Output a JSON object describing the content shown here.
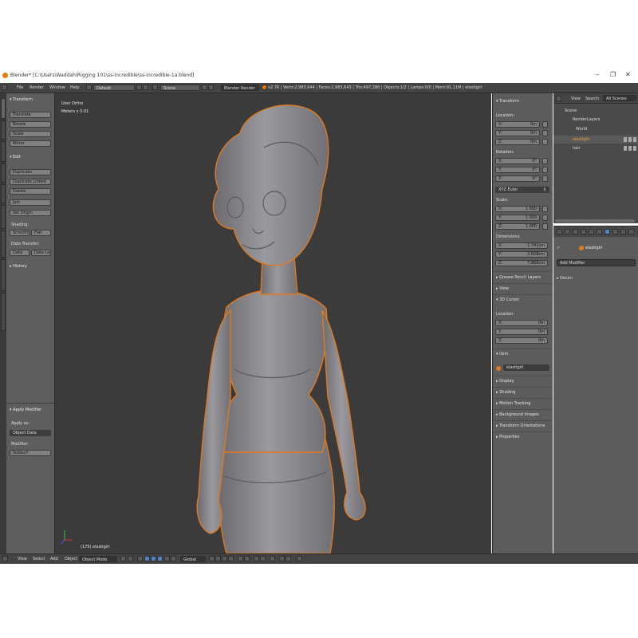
{
  "window": {
    "title": "Blender* [C:\\Users\\Waddah\\Rigging 101\\ss-incredible\\ss-incredible-1a.blend]",
    "controls": [
      "–",
      "❐",
      "✕"
    ]
  },
  "menubar": {
    "menus": [
      "File",
      "Render",
      "Window",
      "Help"
    ],
    "layout": "Default",
    "scene": "Scene",
    "engine": "Blender Render",
    "stats": "v2.76 | Verts:2,983,644 | Faces:2,983,643 | Tris:497,280 | Objects:1/2 | Lamps:0/0 | Mem:91.11M | elastigirl"
  },
  "tools": {
    "transform_header": "▾ Transform",
    "transform": [
      "Translate",
      "Rotate",
      "Scale",
      "Mirror"
    ],
    "edit_header": "▾ Edit",
    "edit": [
      "Duplicate",
      "Duplicate Linked",
      "Delete",
      "Join"
    ],
    "set_origin": "Set Origin",
    "shading_label": "Shading:",
    "shading": [
      "Smooth",
      "Flat"
    ],
    "data_transfer_label": "Data Transfer:",
    "data_transfer": [
      "Data",
      "Data Lay"
    ],
    "history_header": "▸ History",
    "apply_modifier_header": "▾ Apply Modifier",
    "apply_as_label": "Apply as:",
    "apply_as_value": "Object Data",
    "modifier_label": "Modifier:",
    "modifier_value": "Subsurf"
  },
  "viewport": {
    "view_name": "User Ortho",
    "meters": "Meters x 0.01",
    "object_label": "(175) elastigirl"
  },
  "npanel": {
    "transform_header": "▾ Transform",
    "location_label": "Location:",
    "location": [
      {
        "k": "X:",
        "v": "0m"
      },
      {
        "k": "Y:",
        "v": "0m"
      },
      {
        "k": "Z:",
        "v": "0m"
      }
    ],
    "rotation_label": "Rotation:",
    "rotation": [
      {
        "k": "X:",
        "v": "0°"
      },
      {
        "k": "Y:",
        "v": "0°"
      },
      {
        "k": "Z:",
        "v": "0°"
      }
    ],
    "rotation_mode": "XYZ Euler",
    "scale_label": "Scale:",
    "scale": [
      {
        "k": "X:",
        "v": "1.000"
      },
      {
        "k": "Y:",
        "v": "1.000"
      },
      {
        "k": "Z:",
        "v": "1.000"
      }
    ],
    "dimensions_label": "Dimensions:",
    "dimensions": [
      {
        "k": "X:",
        "v": "1.741cm"
      },
      {
        "k": "Y:",
        "v": "2.828cm"
      },
      {
        "k": "Z:",
        "v": "7.868cm"
      }
    ],
    "grease_pencil": "▸ Grease Pencil Layers",
    "view": "▸ View",
    "cursor_header": "▾ 3D Cursor",
    "cursor_location_label": "Location:",
    "cursor": [
      {
        "k": "X:",
        "v": "0m"
      },
      {
        "k": "Y:",
        "v": "0m"
      },
      {
        "k": "Z:",
        "v": "0m"
      }
    ],
    "item_header": "▾ Item",
    "item_name": "elastigirl",
    "sections": [
      "▸ Display",
      "▸ Shading",
      "▸ Motion Tracking",
      "▸ Background Images",
      "▸ Transform Orientations",
      "▸ Properties"
    ]
  },
  "outliner": {
    "tabs": [
      "View",
      "Search",
      "All Scenes"
    ],
    "items": [
      "Scene",
      "RenderLayers",
      "World",
      "elastigirl",
      "hair"
    ]
  },
  "properties": {
    "object": "elastigirl",
    "add_modifier": "Add Modifier",
    "section": "▸ Decim"
  },
  "footer": {
    "menus": [
      "View",
      "Select",
      "Add",
      "Object"
    ],
    "mode": "Object Mode",
    "orientation": "Global"
  },
  "colors": {
    "selection_outline": "#e07a1f",
    "viewport_bg": "#3b3b3b",
    "mesh": "#8a8a8e"
  }
}
